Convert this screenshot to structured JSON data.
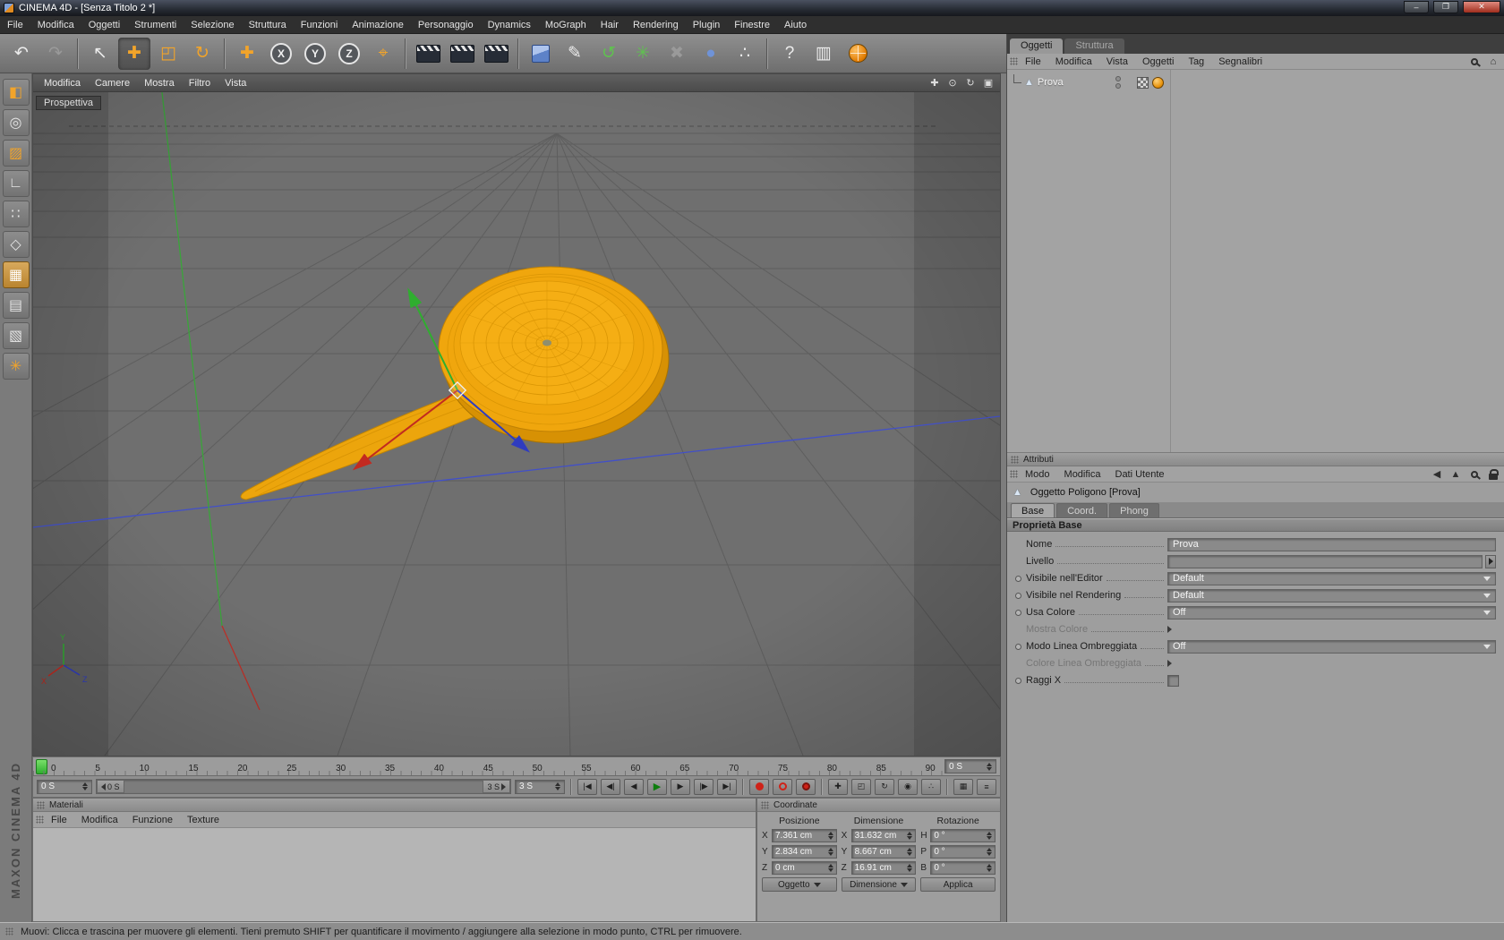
{
  "titlebar": {
    "title": "CINEMA 4D - [Senza Titolo 2 *]"
  },
  "window": {
    "minimize": "–",
    "maximize": "❐",
    "close": "✕"
  },
  "menubar": {
    "items": [
      "File",
      "Modifica",
      "Oggetti",
      "Strumenti",
      "Selezione",
      "Struttura",
      "Funzioni",
      "Animazione",
      "Personaggio",
      "Dynamics",
      "MoGraph",
      "Hair",
      "Rendering",
      "Plugin",
      "Finestre",
      "Aiuto"
    ]
  },
  "icons": {
    "undo": "↶",
    "redo": "↷",
    "live_selection": "↖",
    "move": "✚",
    "scale": "◰",
    "rotate": "↻",
    "last_tool": "✚",
    "axis_x": "X",
    "axis_y": "Y",
    "axis_z": "Z",
    "coord_system": "⌖",
    "spline_pen": "✎",
    "nurbs": "↺",
    "array": "✳",
    "boole": "✖",
    "sphere": "●",
    "particles": "∴",
    "help": "?",
    "layout": "▥",
    "pan_view": "✚",
    "zoom_view": "⊙",
    "rotate_view": "↻",
    "toggle_view": "▣",
    "make_editable": "◧",
    "model_mode": "◎",
    "texture_mode": "▨",
    "workplane_mode": "∟",
    "points_mode": "∷",
    "edges_mode": "◇",
    "polygons_mode": "▦",
    "uv_mode": "▤",
    "texture_axis": "▧",
    "snap_mode": "✳",
    "cone": "▲",
    "home": "⌂",
    "param": "◉",
    "options": "≡",
    "key_sel": "▦"
  },
  "viewport": {
    "menu": [
      "Modifica",
      "Camere",
      "Mostra",
      "Filtro",
      "Vista"
    ],
    "label": "Prospettiva"
  },
  "timeline": {
    "ticks": [
      "0",
      "5",
      "10",
      "15",
      "20",
      "25",
      "30",
      "35",
      "40",
      "45",
      "50",
      "55",
      "60",
      "65",
      "70",
      "75",
      "80",
      "85",
      "90"
    ],
    "current": "0 S",
    "start": "0 S",
    "slider_start": "0 S",
    "slider_end": "3 S",
    "end": "3 S",
    "controls": {
      "goto_start": "|◀",
      "prev_key": "◀|",
      "prev_frame": "◀",
      "play": "▶",
      "next_frame": "▶",
      "next_key": "|▶",
      "goto_end": "▶|"
    }
  },
  "materials": {
    "title": "Materiali",
    "menu": [
      "File",
      "Modifica",
      "Funzione",
      "Texture"
    ]
  },
  "coordinates": {
    "title": "Coordinate",
    "columns": [
      "Posizione",
      "Dimensione",
      "Rotazione"
    ],
    "labels": {
      "x": "X",
      "y": "Y",
      "z": "Z",
      "h": "H",
      "p": "P",
      "b": "B"
    },
    "position": {
      "x": "7.361 cm",
      "y": "2.834 cm",
      "z": "0 cm"
    },
    "size": {
      "x": "31.632 cm",
      "y": "8.667 cm",
      "z": "16.91 cm"
    },
    "rotation": {
      "h": "0 °",
      "p": "0 °",
      "b": "0 °"
    },
    "buttons": {
      "mode1": "Oggetto",
      "mode2": "Dimensione",
      "apply": "Applica"
    }
  },
  "object_manager": {
    "tabs": [
      "Oggetti",
      "Struttura"
    ],
    "menu": [
      "File",
      "Modifica",
      "Vista",
      "Oggetti",
      "Tag",
      "Segnalibri"
    ],
    "objects": [
      {
        "name": "Prova"
      }
    ]
  },
  "attributes": {
    "title": "Attributi",
    "menu": [
      "Modo",
      "Modifica",
      "Dati Utente"
    ],
    "object_title": "Oggetto Poligono [Prova]",
    "tabs": [
      "Base",
      "Coord.",
      "Phong"
    ],
    "section": "Proprietà Base",
    "rows": {
      "nome": {
        "label": "Nome",
        "value": "Prova"
      },
      "livello": {
        "label": "Livello"
      },
      "vis_editor": {
        "label": "Visibile nell'Editor",
        "value": "Default"
      },
      "vis_render": {
        "label": "Visibile nel Rendering",
        "value": "Default"
      },
      "usa_colore": {
        "label": "Usa Colore",
        "value": "Off"
      },
      "mostra_colore": {
        "label": "Mostra Colore"
      },
      "modo_linea": {
        "label": "Modo Linea Ombreggiata",
        "value": "Off"
      },
      "colore_linea": {
        "label": "Colore Linea Ombreggiata"
      },
      "raggi_x": {
        "label": "Raggi X"
      }
    }
  },
  "statusbar": {
    "text": "Muovi: Clicca e trascina per muovere gli elementi. Tieni premuto SHIFT per quantificare il movimento / aggiungere alla selezione in modo punto, CTRL per rimuovere."
  },
  "branding": {
    "vertical": "MAXON CINEMA 4D"
  },
  "colors": {
    "accent_orange": "#f0a60d",
    "axis_green": "#3aa53a",
    "axis_red": "#c03028",
    "axis_blue": "#4250c8",
    "object_orange": "#f0a60d"
  }
}
